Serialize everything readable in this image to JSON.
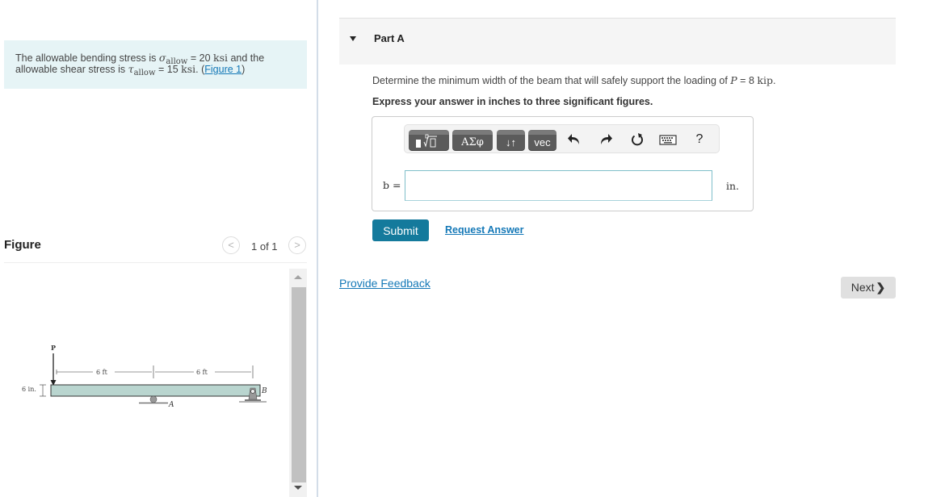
{
  "intro": {
    "line1_prefix": "The allowable bending stress is ",
    "sigma_symbol": "σ",
    "sigma_sub": "allow",
    "sigma_eq": " = 20 ",
    "sigma_unit": "ksi",
    "line1_suffix": " and the",
    "line2_prefix": "allowable shear stress is ",
    "tau_symbol": "τ",
    "tau_sub": "allow",
    "tau_eq": " = 15 ",
    "tau_unit": "ksi",
    "line2_suffix": ". (",
    "figure_link": "Figure 1",
    "close_paren": ")"
  },
  "figure": {
    "title": "Figure",
    "prev_icon": "<",
    "next_icon": ">",
    "counter": "1 of 1",
    "diagram": {
      "load_label": "P",
      "span1_label": "6 ft",
      "span2_label": "6 ft",
      "depth_label": "6 in.",
      "support_a_label": "A",
      "support_b_label": "B",
      "beam_color": "#b9d5cf"
    }
  },
  "part": {
    "title": "Part A",
    "question_prefix": "Determine the minimum width of the beam that will safely support the loading of ",
    "question_var": "P",
    "question_eq": " = 8 ",
    "question_unit": "kip",
    "question_suffix": ".",
    "instruction": "Express your answer in inches to three significant figures.",
    "toolbar": {
      "greek_label": "ΑΣφ",
      "arrows_label": "↓↑",
      "vec_label": "vec",
      "undo_icon": "↶",
      "redo_icon": "↷",
      "reset_icon": "↻",
      "keyboard_icon": "⌨",
      "help_label": "?"
    },
    "variable_label": "b =",
    "answer_value": "",
    "unit_label": "in.",
    "submit_label": "Submit",
    "request_answer_label": "Request Answer"
  },
  "footer": {
    "feedback_label": "Provide Feedback",
    "next_label": "Next",
    "next_icon": "❯"
  },
  "colors": {
    "accent": "#147a9c",
    "link": "#1478b7",
    "intro_bg": "#e6f4f6"
  }
}
